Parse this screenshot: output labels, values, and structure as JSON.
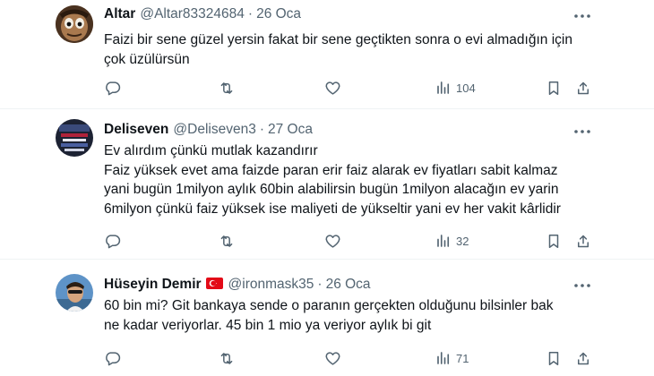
{
  "tweets": [
    {
      "name": "Altar",
      "handle": "@Altar83324684",
      "separator": "·",
      "date": "26 Oca",
      "lines": [
        "Faizi bir sene güzel yersin fakat bir sene geçtikten sonra o evi almadığın için",
        "çok üzülürsün"
      ],
      "views": "104",
      "flag": false
    },
    {
      "name": "Deliseven",
      "handle": "@Deliseven3",
      "separator": "·",
      "date": "27 Oca",
      "lines": [
        "Ev alırdım çünkü mutlak kazandırır",
        "Faiz yüksek evet ama faizde paran erir faiz alarak ev fiyatları sabit kalmaz",
        "yani bugün 1milyon aylık 60bin alabilirsin bugün 1milyon alacağın ev yarin",
        "6milyon çünkü faiz yüksek ise maliyeti de yükseltir yani ev her vakit kârlidir"
      ],
      "views": "32",
      "flag": false
    },
    {
      "name": "Hüseyin Demir",
      "handle": "@ironmask35",
      "separator": "·",
      "date": "26 Oca",
      "lines": [
        "60 bin mi? Git bankaya sende o paranın gerçekten olduğunu bilsinler bak",
        "ne kadar veriyorlar. 45 bin 1 mio ya veriyor aylık bi git"
      ],
      "views": "71",
      "flag": true
    }
  ],
  "icons": {
    "more": "more-horizontal-icon",
    "reply": "reply-icon",
    "retweet": "retweet-icon",
    "like": "heart-icon",
    "views": "views-icon",
    "bookmark": "bookmark-icon",
    "share": "share-icon"
  },
  "colors": {
    "text": "#0f1419",
    "muted": "#536471",
    "divider": "#eff3f4",
    "flag_red": "#e30a17"
  }
}
